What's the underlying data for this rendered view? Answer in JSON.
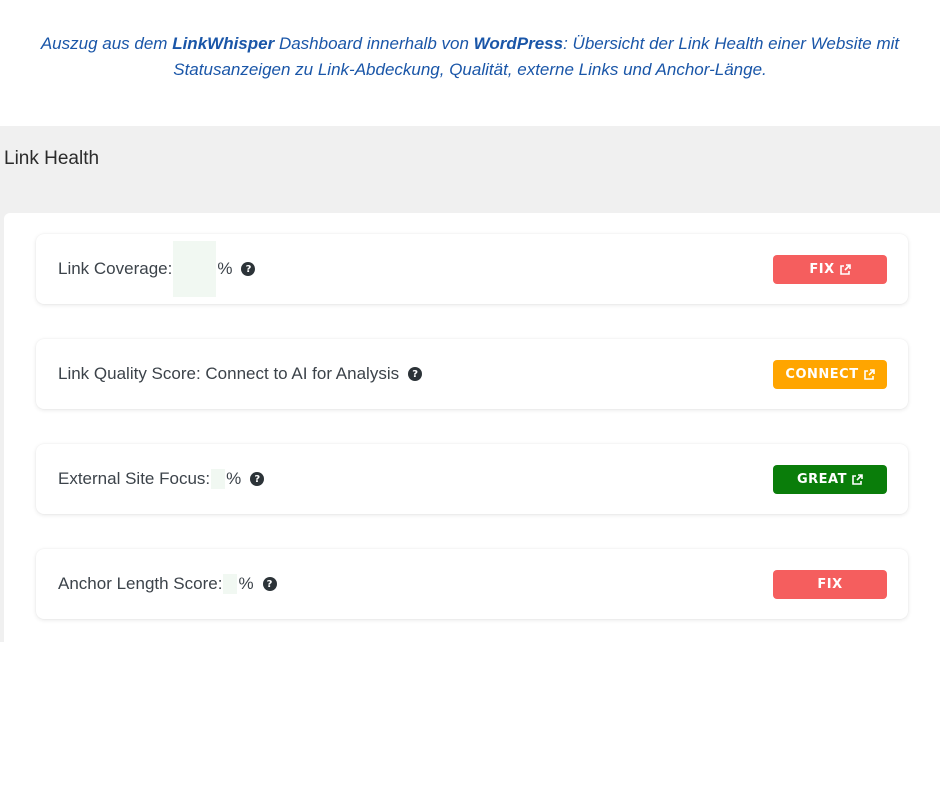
{
  "caption": {
    "prefix": "Auszug aus dem ",
    "brand": "LinkWhisper",
    "middle": " Dashboard innerhalb von ",
    "platform": "WordPress",
    "suffix": ": Übersicht der Link Health einer Website mit Statusanzeigen zu Link-Abdeckung, Qualität, externe Links und Anchor-Länge."
  },
  "panel": {
    "title": "Link Health"
  },
  "rows": [
    {
      "label": "Link Coverage:",
      "suffix": "%",
      "button": "FIX",
      "color": "#f55e5e",
      "external": true
    },
    {
      "label": "Link Quality Score: Connect to AI for Analysis",
      "suffix": "",
      "button": "CONNECT",
      "color": "#ffa500",
      "external": true
    },
    {
      "label": "External Site Focus:",
      "suffix": "%",
      "button": "GREAT",
      "color": "#0a7d0a",
      "external": true
    },
    {
      "label": "Anchor Length Score:",
      "suffix": "%",
      "button": "FIX",
      "color": "#f55e5e",
      "external": false
    }
  ]
}
